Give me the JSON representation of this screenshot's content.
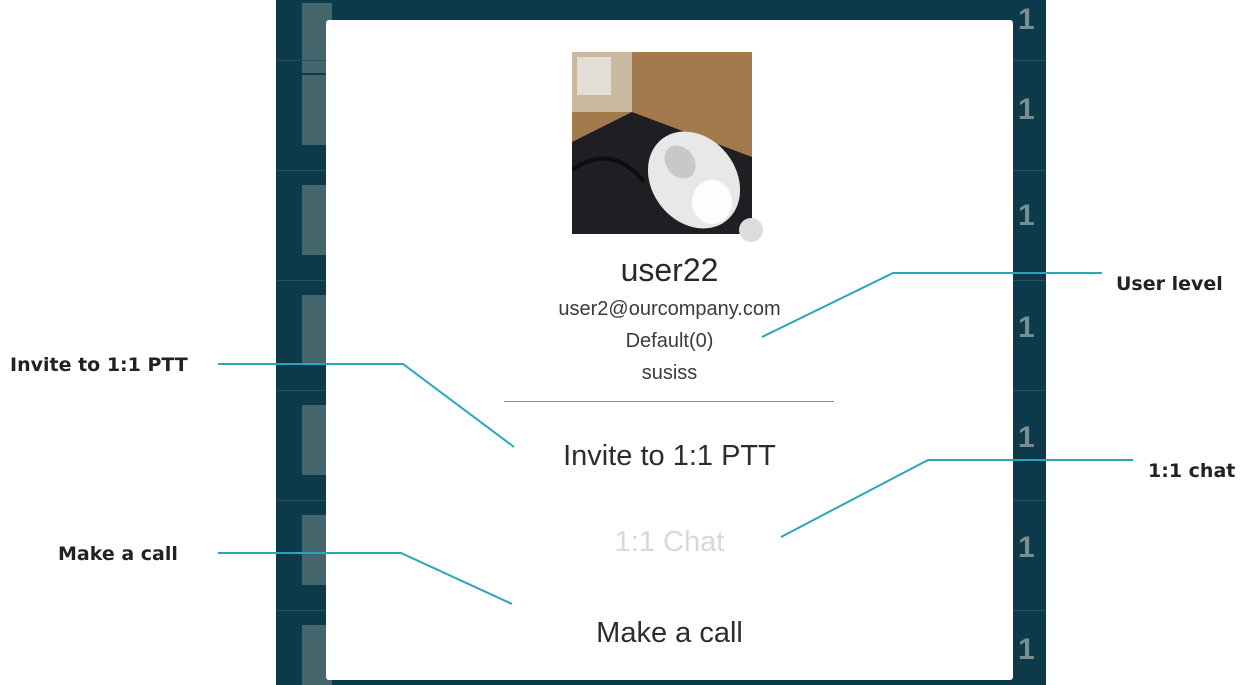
{
  "background": {
    "row_count_label": "1",
    "colors": {
      "app_bg": "#0d3a4a",
      "thumb": "#516e74"
    }
  },
  "dialog": {
    "avatar_icon": "user-photo",
    "username": "user22",
    "email": "user2@ourcompany.com",
    "level": "Default(0)",
    "group": "susiss",
    "actions": {
      "invite_label": "Invite to 1:1 PTT",
      "chat_label": "1:1 Chat",
      "call_label": "Make a call"
    }
  },
  "callouts": {
    "user_level": "User level",
    "invite": "Invite to 1:1 PTT",
    "chat": "1:1 chat",
    "call": "Make a call"
  },
  "colors": {
    "callout_line": "#2aa6bb"
  }
}
